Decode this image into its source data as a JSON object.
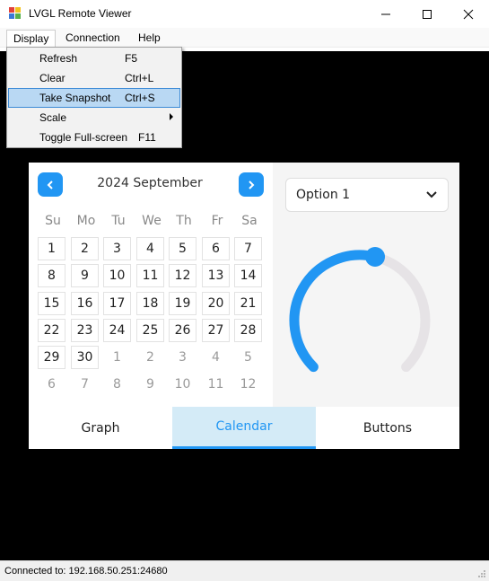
{
  "window": {
    "title": "LVGL Remote Viewer",
    "minimize_icon": "minimize-icon",
    "maximize_icon": "maximize-icon",
    "close_icon": "close-icon"
  },
  "menu": {
    "items": [
      "Display",
      "Connection",
      "Help"
    ]
  },
  "display_menu": {
    "items": [
      {
        "label": "Refresh",
        "shortcut": "F5"
      },
      {
        "label": "Clear",
        "shortcut": "Ctrl+L"
      },
      {
        "label": "Take Snapshot",
        "shortcut": "Ctrl+S",
        "highlighted": true
      },
      {
        "label": "Scale",
        "shortcut": "",
        "submenu": true
      },
      {
        "label": "Toggle Full-screen",
        "shortcut": "F11"
      }
    ]
  },
  "calendar": {
    "header": "2024 September",
    "days_of_week": [
      "Su",
      "Mo",
      "Tu",
      "We",
      "Th",
      "Fr",
      "Sa"
    ],
    "weeks": [
      [
        "1",
        "2",
        "3",
        "4",
        "5",
        "6",
        "7"
      ],
      [
        "8",
        "9",
        "10",
        "11",
        "12",
        "13",
        "14"
      ],
      [
        "15",
        "16",
        "17",
        "18",
        "19",
        "20",
        "21"
      ],
      [
        "22",
        "23",
        "24",
        "25",
        "26",
        "27",
        "28"
      ],
      [
        "29",
        "30",
        "1",
        "2",
        "3",
        "4",
        "5"
      ],
      [
        "6",
        "7",
        "8",
        "9",
        "10",
        "11",
        "12"
      ]
    ],
    "accent_color": "#2196f3"
  },
  "dropdown": {
    "selected": "Option 1"
  },
  "arc": {
    "value_fraction": 0.55,
    "color": "#2196f3",
    "track_color": "#e6e3e6"
  },
  "tabs": [
    {
      "label": "Graph",
      "active": false
    },
    {
      "label": "Calendar",
      "active": true
    },
    {
      "label": "Buttons",
      "active": false
    }
  ],
  "status": {
    "text": "Connected to: 192.168.50.251:24680"
  }
}
